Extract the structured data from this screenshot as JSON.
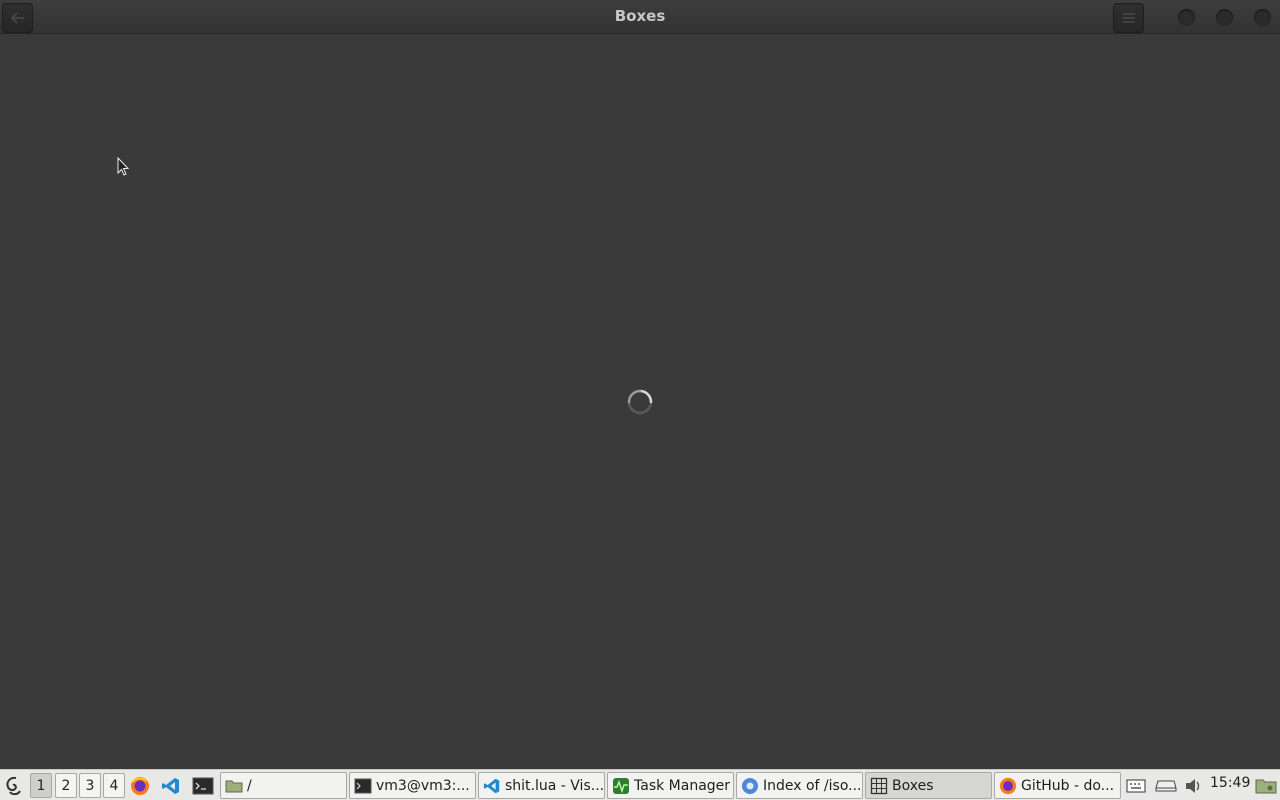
{
  "window": {
    "title": "Boxes"
  },
  "header": {
    "back_icon": "back-arrow-icon",
    "menu_icon": "hamburger-menu-icon",
    "window_controls": [
      "minimize",
      "maximize",
      "close"
    ]
  },
  "main": {
    "state": "loading",
    "spinner_icon": "loading-spinner-icon"
  },
  "taskbar": {
    "launcher_icon": "debian-swirl-icon",
    "workspaces": [
      "1",
      "2",
      "3",
      "4"
    ],
    "active_workspace": "1",
    "quicklaunch": [
      "firefox-icon",
      "vscode-icon",
      "terminal-icon"
    ],
    "tasks": [
      {
        "label": "/",
        "icon": "folder-icon"
      },
      {
        "label": "vm3@vm3:...",
        "icon": "terminal-icon"
      },
      {
        "label": "shit.lua - Vis...",
        "icon": "vscode-icon"
      },
      {
        "label": "Task Manager",
        "icon": "task-manager-icon"
      },
      {
        "label": "Index of /iso...",
        "icon": "chromium-icon"
      },
      {
        "label": "Boxes",
        "icon": "boxes-icon",
        "active": true
      },
      {
        "label": "GitHub - do...",
        "icon": "firefox-icon"
      }
    ],
    "tray": [
      "keyboard-icon",
      "drive-icon",
      "volume-icon"
    ],
    "clock": "15:49",
    "tray_end_icon": "folder-icon"
  },
  "colors": {
    "content_bg": "#3a3a3a",
    "taskbar_bg": "#e8e8e6"
  }
}
